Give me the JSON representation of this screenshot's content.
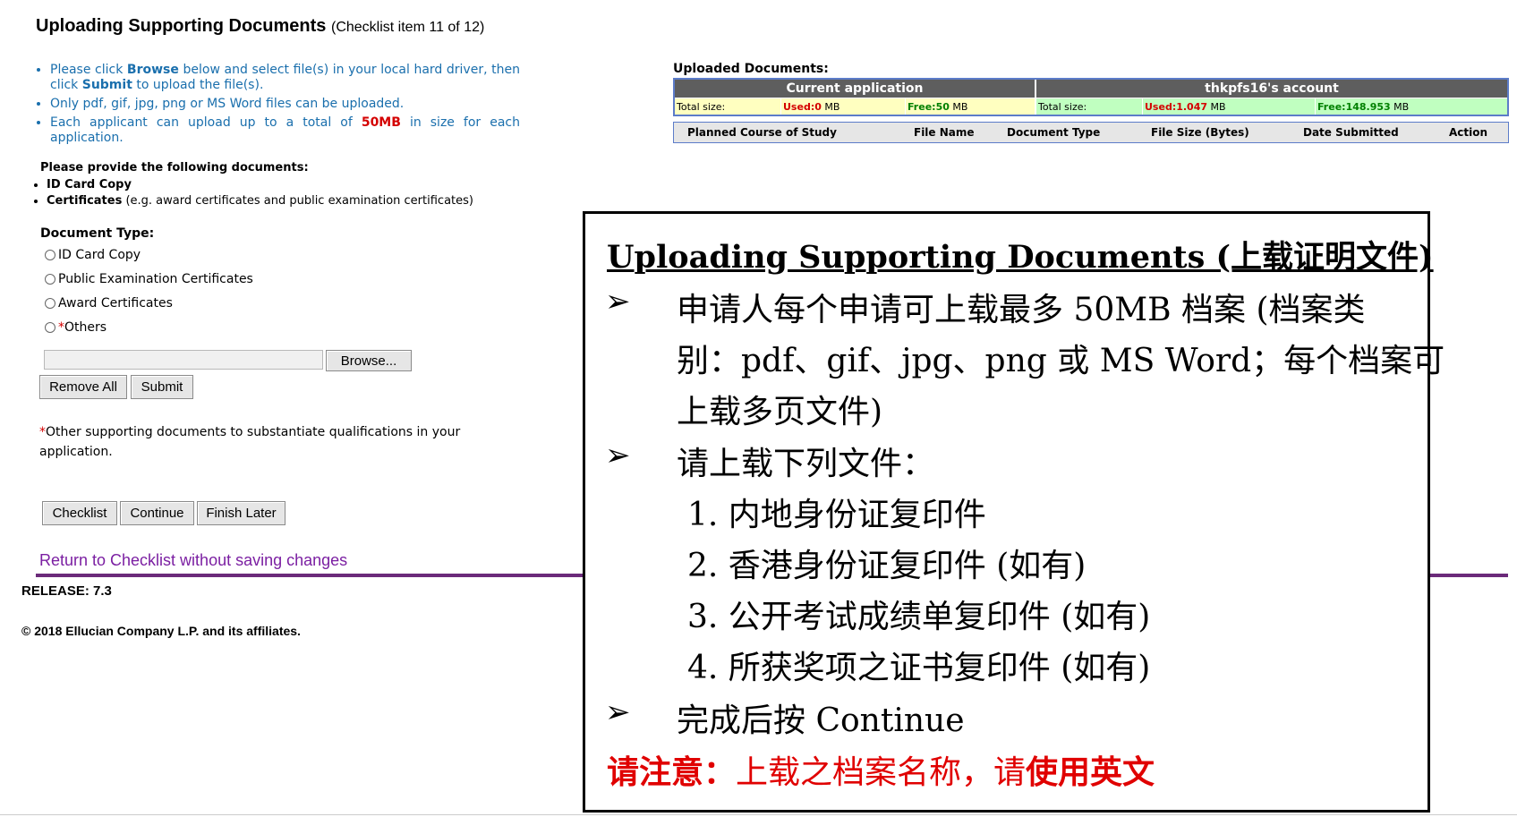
{
  "header": {
    "title": "Uploading Supporting Documents",
    "subtitle": "(Checklist item 11 of 12)"
  },
  "instructions": {
    "line1_a": "Please click ",
    "line1_browse": "Browse",
    "line1_b": " below and select file(s) in your local hard driver, then click ",
    "line1_submit": "Submit",
    "line1_c": " to upload the file(s).",
    "line2": "Only pdf, gif, jpg, png or MS Word files can be uploaded.",
    "line3_a": "Each applicant can upload up to a total of ",
    "line3_size": "50MB",
    "line3_b": " in size for each application."
  },
  "required_docs": {
    "title": "Please provide the following documents:",
    "item1": "ID Card Copy",
    "item2_bold": "Certificates",
    "item2_rest": " (e.g. award certificates and public examination certificates)"
  },
  "document_type": {
    "label": "Document Type:",
    "options": [
      "ID Card Copy",
      "Public Examination Certificates",
      "Award Certificates",
      "Others"
    ],
    "others_star": "*"
  },
  "file_input": {
    "browse_label": "Browse..."
  },
  "actions": {
    "remove_all": "Remove All",
    "submit": "Submit",
    "checklist": "Checklist",
    "continue": "Continue",
    "finish_later": "Finish Later"
  },
  "note": {
    "star": "*",
    "text": "Other supporting documents to substantiate qualifications in your application."
  },
  "links": {
    "return": "Return to Checklist without saving changes"
  },
  "footer": {
    "release": "RELEASE: 7.3",
    "copyright": "© 2018 Ellucian Company L.P. and its affiliates."
  },
  "uploaded": {
    "title": "Uploaded Documents:",
    "current_header": "Current application",
    "account_header": "thkpfs16's account",
    "total_size_label": "Total size:",
    "used_label": "Used: ",
    "free_label": "Free: ",
    "unit": "MB",
    "current_used": "0",
    "current_free": "50",
    "account_used": "1.047",
    "account_free": "148.953",
    "columns": [
      "Planned Course of Study",
      "File Name",
      "Document Type",
      "File Size (Bytes)",
      "Date Submitted",
      "Action"
    ]
  },
  "overlay": {
    "title": "Uploading Supporting Documents (上载证明文件)",
    "bullet1_l1": "申请人每个申请可上载最多 50MB 档案 (档案类",
    "bullet1_l2": "别：pdf、gif、jpg、png 或 MS Word；每个档案可",
    "bullet1_l3": "上载多页文件)",
    "bullet2": "请上载下列文件：",
    "list": [
      "1.   内地身份证复印件",
      "2.   香港身份证复印件 (如有)",
      "3.   公开考试成绩单复印件 (如有)",
      "4.   所获奖项之证书复印件 (如有)"
    ],
    "bullet3": "完成后按 Continue",
    "warn_a": "请注意：",
    "warn_b": "上载之档案名称，请",
    "warn_c": "使用英文",
    "arrow": "➢"
  }
}
